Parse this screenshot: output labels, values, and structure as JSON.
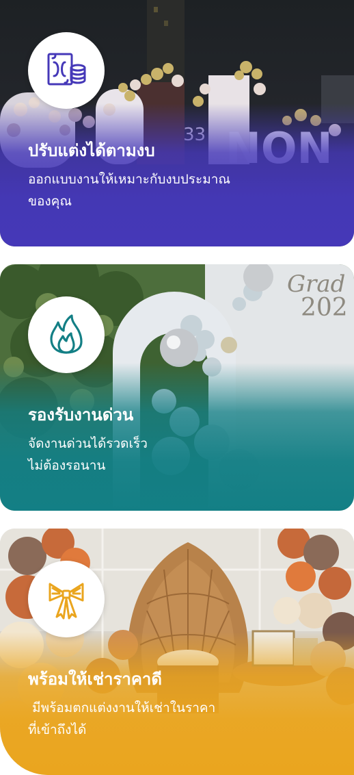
{
  "cards": [
    {
      "icon": "money-coins-icon",
      "title": "ปรับแต่งได้ตามงบ",
      "description_lines": [
        "ออกแบบงานให้เหมาะกับงบประมาณ",
        "ของคุณ"
      ],
      "accent": "#4538b8"
    },
    {
      "icon": "flame-icon",
      "title": "รองรับงานด่วน",
      "description_lines": [
        "จัดงานด่วนได้รวดเร็ว",
        "ไม่ต้องรอนาน"
      ],
      "accent": "#137f85"
    },
    {
      "icon": "ribbon-bow-icon",
      "title": "พร้อมให้เช่าราคาดี",
      "description_lines": [
        " มีพร้อมตกแต่งงานให้เช่าในราคา",
        "ที่เข้าถึงได้"
      ],
      "accent": "#eaa51e"
    }
  ]
}
